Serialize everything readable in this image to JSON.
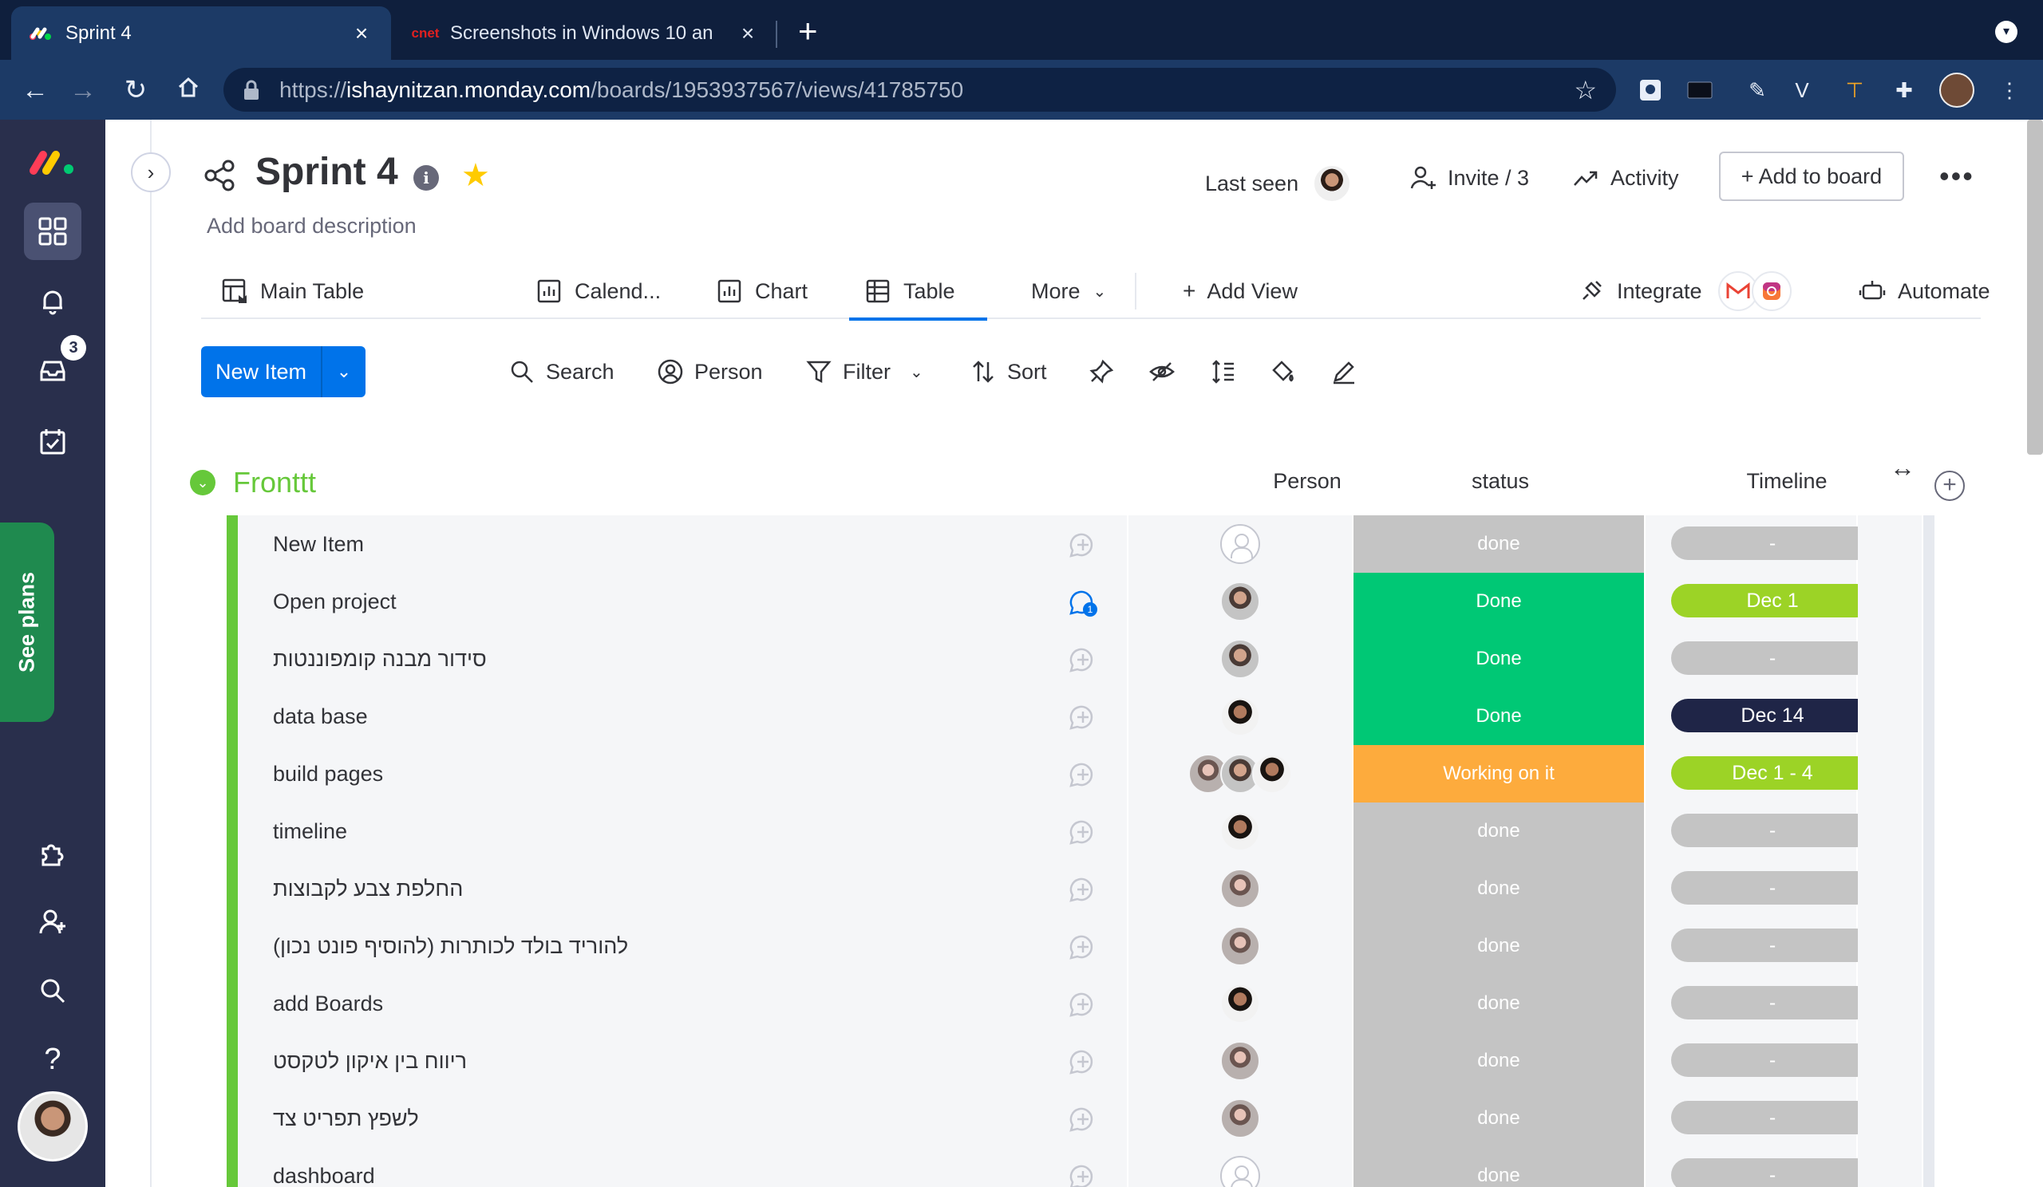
{
  "browser": {
    "tabs": [
      {
        "title": "Sprint 4",
        "active": true,
        "favicon": "monday-logo-icon"
      },
      {
        "title": "Screenshots in Windows 10 an",
        "active": false,
        "favicon": "cnet-icon",
        "favicon_text": "cnet"
      }
    ],
    "url": {
      "scheme": "https://",
      "host": "ishaynitzan.monday.com",
      "path": "/boards/1953937567/views/41785750"
    }
  },
  "sidebar": {
    "inbox_badge": "3",
    "see_plans": "See plans"
  },
  "board": {
    "title": "Sprint 4",
    "description": "Add board description",
    "last_seen": "Last seen",
    "invite": "Invite / 3",
    "activity": "Activity",
    "add_to_board": "+ Add to board",
    "more": "•••"
  },
  "views": {
    "tabs": [
      "Main Table",
      "Calend...",
      "Chart",
      "Table",
      "More"
    ],
    "active": "Table",
    "add_view": "Add View",
    "integrate": "Integrate",
    "automate": "Automate"
  },
  "toolbar": {
    "new_item": "New Item",
    "search": "Search",
    "person": "Person",
    "filter": "Filter",
    "sort": "Sort"
  },
  "group": {
    "name": "Fronttt",
    "color": "#66c83a",
    "columns": {
      "person": "Person",
      "status": "status",
      "timeline": "Timeline"
    },
    "rows": [
      {
        "name": "New Item",
        "people": [
          "empty"
        ],
        "status": "done",
        "status_color": "#c4c4c4",
        "timeline": "-",
        "timeline_color": "#c4c4c4",
        "updates": ""
      },
      {
        "name": "Open project",
        "people": [
          "a"
        ],
        "status": "Done",
        "status_color": "#00c875",
        "timeline": "Dec 1",
        "timeline_color": "#9cd326",
        "updates": "1"
      },
      {
        "name": "סידור מבנה קומפוננטות",
        "people": [
          "a"
        ],
        "status": "Done",
        "status_color": "#00c875",
        "timeline": "-",
        "timeline_color": "#c4c4c4",
        "updates": ""
      },
      {
        "name": "data base",
        "people": [
          "b"
        ],
        "status": "Done",
        "status_color": "#00c875",
        "timeline": "Dec 14",
        "timeline_color": "#1f2547",
        "updates": ""
      },
      {
        "name": "build pages",
        "people": [
          "c",
          "a",
          "b"
        ],
        "status": "Working on it",
        "status_color": "#fdab3d",
        "timeline": "Dec 1 - 4",
        "timeline_color": "#9cd326",
        "updates": ""
      },
      {
        "name": "timeline",
        "people": [
          "b"
        ],
        "status": "done",
        "status_color": "#c4c4c4",
        "timeline": "-",
        "timeline_color": "#c4c4c4",
        "updates": ""
      },
      {
        "name": "החלפת צבע לקבוצות",
        "people": [
          "c"
        ],
        "status": "done",
        "status_color": "#c4c4c4",
        "timeline": "-",
        "timeline_color": "#c4c4c4",
        "updates": ""
      },
      {
        "name": "להוריד בולד לכותרות (להוסיף פונט נכון)",
        "people": [
          "c"
        ],
        "status": "done",
        "status_color": "#c4c4c4",
        "timeline": "-",
        "timeline_color": "#c4c4c4",
        "updates": ""
      },
      {
        "name": "add Boards",
        "people": [
          "b"
        ],
        "status": "done",
        "status_color": "#c4c4c4",
        "timeline": "-",
        "timeline_color": "#c4c4c4",
        "updates": ""
      },
      {
        "name": "ריווח בין איקון לטקסט",
        "people": [
          "c"
        ],
        "status": "done",
        "status_color": "#c4c4c4",
        "timeline": "-",
        "timeline_color": "#c4c4c4",
        "updates": ""
      },
      {
        "name": "לשפץ תפריט צד",
        "people": [
          "c"
        ],
        "status": "done",
        "status_color": "#c4c4c4",
        "timeline": "-",
        "timeline_color": "#c4c4c4",
        "updates": ""
      },
      {
        "name": "dashboard",
        "people": [
          "empty"
        ],
        "status": "done",
        "status_color": "#c4c4c4",
        "timeline": "-",
        "timeline_color": "#c4c4c4",
        "updates": ""
      }
    ]
  }
}
